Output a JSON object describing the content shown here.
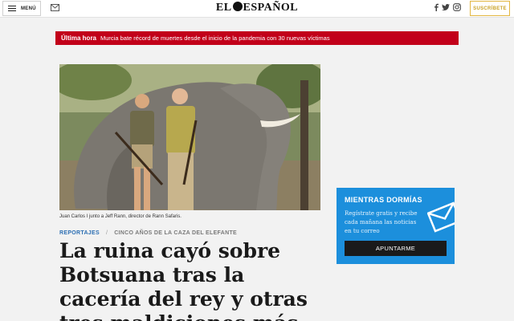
{
  "header": {
    "menu_label": "MENÚ",
    "logo_text_left": "EL",
    "logo_text_right": "ESPAÑOL",
    "subscribe_label": "SUSCRÍBETE",
    "icons": [
      "menu-icon",
      "mail-icon",
      "facebook-icon",
      "twitter-icon",
      "instagram-icon"
    ]
  },
  "breaking": {
    "tag": "Última hora",
    "text": "Murcia bate récord de muertes desde el inicio de la pandemia con 30 nuevas víctimas"
  },
  "article": {
    "caption": "Juan Carlos I junto a Jeff Rann, director de Rann Safaris.",
    "section": "REPORTAJES",
    "separator": "/",
    "subsection": "CINCO AÑOS DE LA CAZA DEL ELEFANTE",
    "headline": "La ruina cayó sobre Botsuana tras la cacería del rey y otras tres maldiciones más"
  },
  "newsletter": {
    "title": "MIENTRAS DORMÍAS",
    "body": "Regístrate gratis y recibe cada mañana las noticias en tu correo",
    "cta": "APUNTARME"
  },
  "colors": {
    "breaking_bg": "#c2001a",
    "newsletter_bg": "#1c8fdc",
    "section_blue": "#2d6fb3",
    "subscribe_gold": "#c9a227"
  }
}
